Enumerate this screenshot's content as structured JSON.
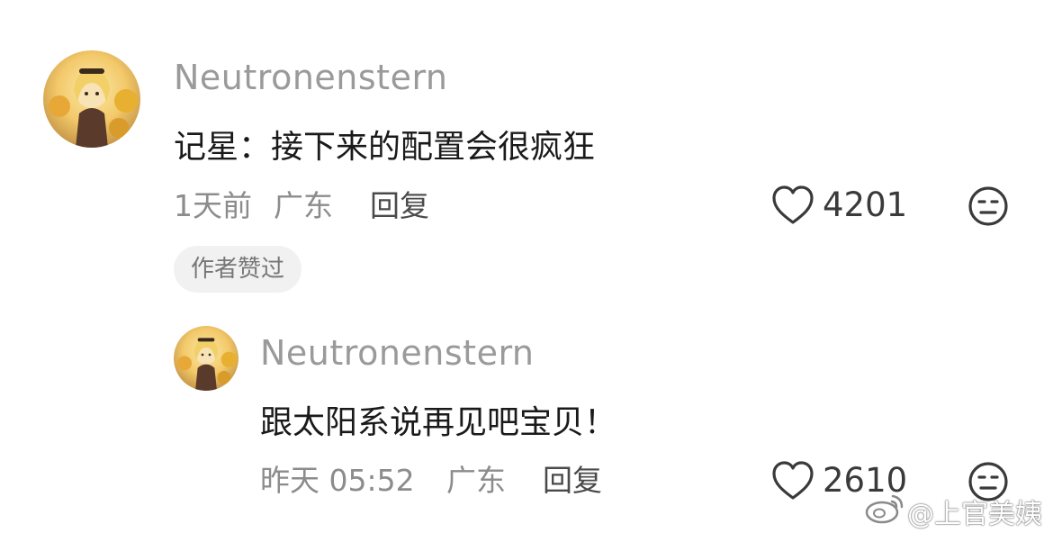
{
  "comment": {
    "username": "Neutronenstern",
    "text": "记星：接下来的配置会很疯狂",
    "time": "1天前",
    "location": "广东",
    "reply_label": "回复",
    "like_count": "4201",
    "author_badge": "作者赞过"
  },
  "reply": {
    "username": "Neutronenstern",
    "text": "跟太阳系说再见吧宝贝！",
    "time": "昨天 05:52",
    "location": "广东",
    "reply_label": "回复",
    "like_count": "2610"
  },
  "watermark": {
    "text": "@上官美姨"
  },
  "colors": {
    "username": "#9a9a9a",
    "meta": "#8c8c8c",
    "icon_stroke": "#3a3a3a"
  }
}
